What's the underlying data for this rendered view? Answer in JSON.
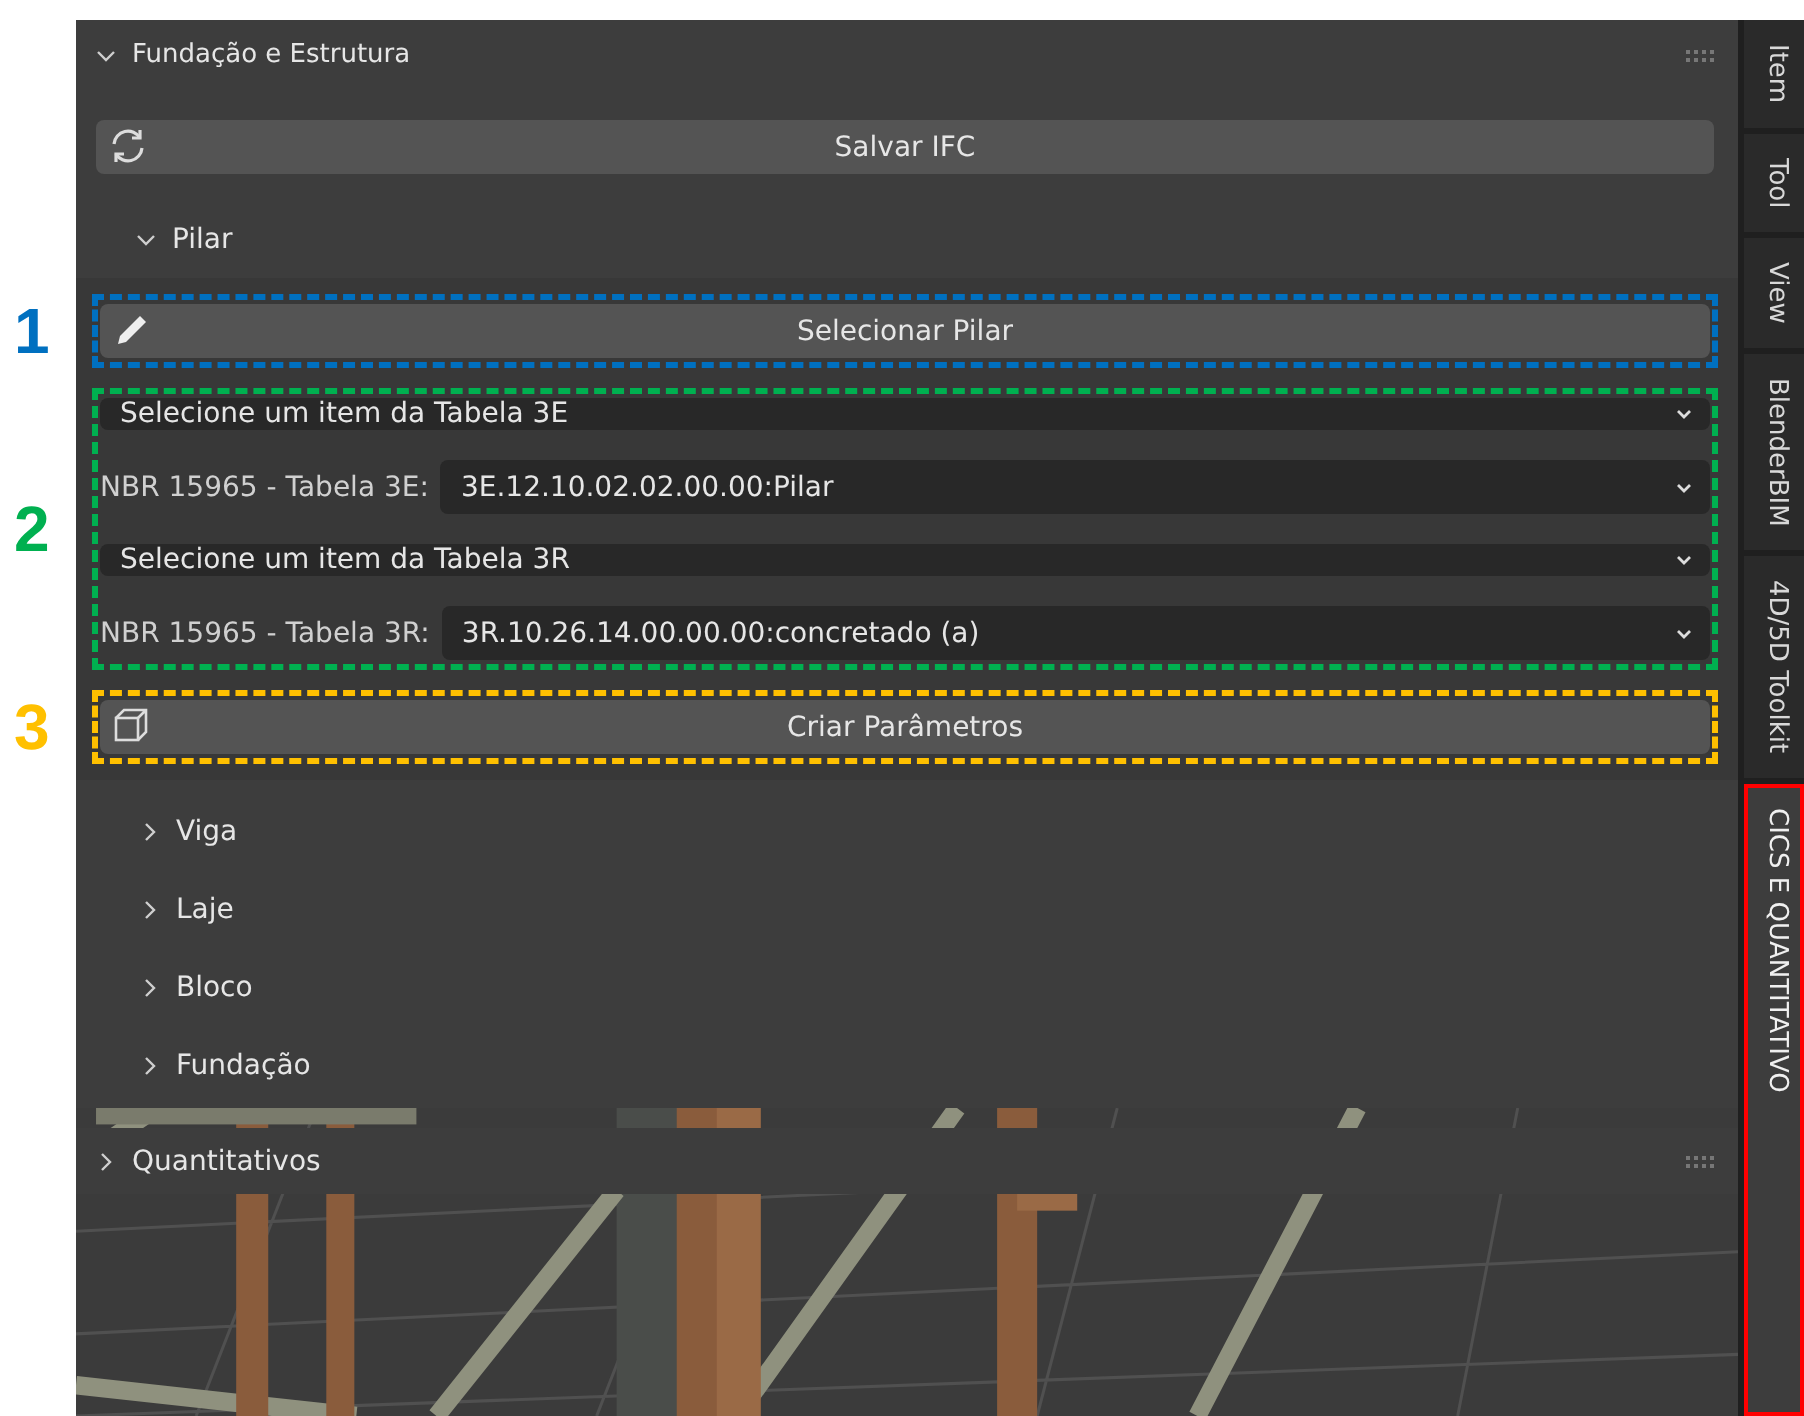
{
  "panel": {
    "title": "Fundação e Estrutura",
    "expanded": true,
    "save_button": {
      "label": "Salvar IFC"
    },
    "subsections": [
      {
        "title": "Pilar",
        "expanded": true,
        "groups": [
          {
            "annotation": {
              "label": "1",
              "color": "#0070c0"
            },
            "items": [
              {
                "kind": "button",
                "label": "Selecionar Pilar"
              }
            ]
          },
          {
            "annotation": {
              "label": "2",
              "color": "#00b050"
            },
            "items": [
              {
                "kind": "select",
                "value": "Selecione um item da Tabela 3E"
              },
              {
                "kind": "labeled_select",
                "label": "NBR 15965 - Tabela 3E:",
                "value": "3E.12.10.02.02.00.00:Pilar"
              },
              {
                "kind": "select",
                "value": "Selecione um item da Tabela 3R"
              },
              {
                "kind": "labeled_select",
                "label": "NBR 15965 - Tabela 3R:",
                "value": "3R.10.26.14.00.00.00:concretado (a)"
              }
            ]
          },
          {
            "annotation": {
              "label": "3",
              "color": "#ffc000"
            },
            "items": [
              {
                "kind": "button",
                "label": "Criar Parâmetros"
              }
            ]
          }
        ]
      },
      {
        "title": "Viga",
        "expanded": false
      },
      {
        "title": "Laje",
        "expanded": false
      },
      {
        "title": "Bloco",
        "expanded": false
      },
      {
        "title": "Fundação",
        "expanded": false
      }
    ]
  },
  "quantitativos": {
    "title": "Quantitativos",
    "expanded": false
  },
  "tabs": [
    {
      "label": "Item",
      "selected": false
    },
    {
      "label": "Tool",
      "selected": false
    },
    {
      "label": "View",
      "selected": false
    },
    {
      "label": "BlenderBIM",
      "selected": false
    },
    {
      "label": "4D/5D Toolkit",
      "selected": false
    },
    {
      "label": "CICS E QUANTITATIVO",
      "selected": true
    }
  ]
}
